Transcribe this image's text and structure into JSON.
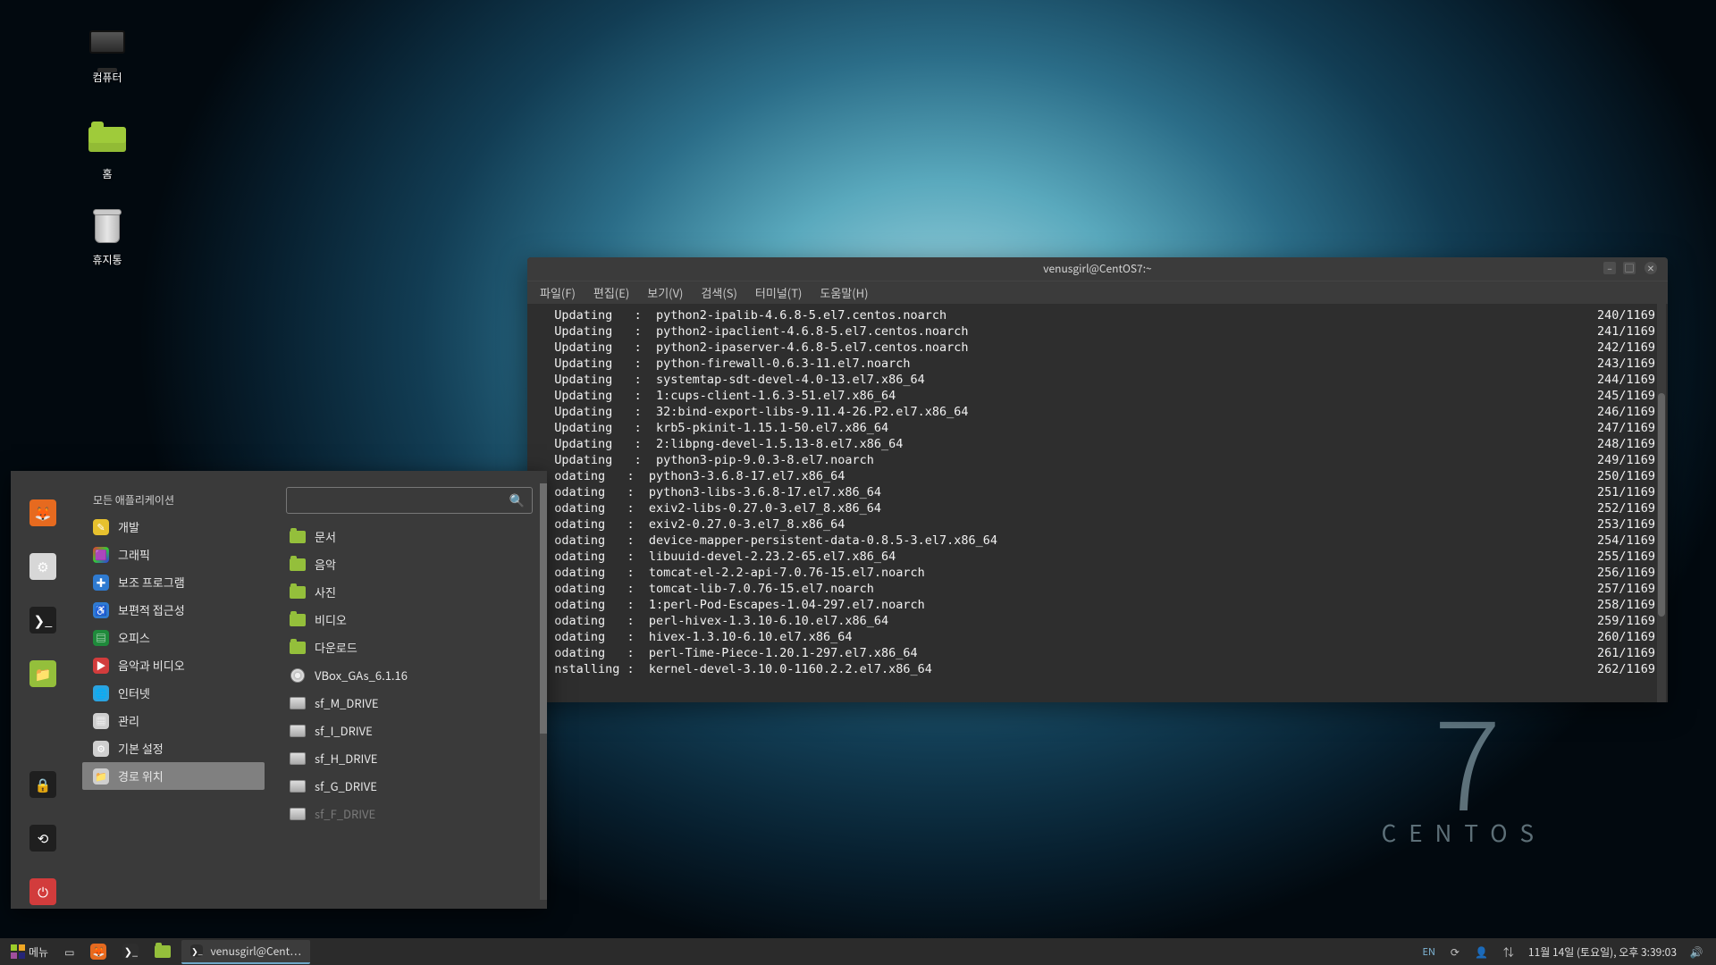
{
  "desktop": {
    "icons": [
      {
        "name": "computer",
        "label": "컴퓨터"
      },
      {
        "name": "home",
        "label": "홈"
      },
      {
        "name": "trash",
        "label": "휴지통"
      }
    ]
  },
  "wallpaper": {
    "big": "7",
    "name": "CENTOS"
  },
  "terminal": {
    "title": "venusgirl@CentOS7:~",
    "menu": [
      "파일(F)",
      "편집(E)",
      "보기(V)",
      "검색(S)",
      "터미널(T)",
      "도움말(H)"
    ],
    "total": "1169",
    "lines": [
      {
        "action": "Updating",
        "sep": "   :  ",
        "pkg": "python2-ipalib-4.6.8-5.el7.centos.noarch",
        "count": "240"
      },
      {
        "action": "Updating",
        "sep": "   :  ",
        "pkg": "python2-ipaclient-4.6.8-5.el7.centos.noarch",
        "count": "241"
      },
      {
        "action": "Updating",
        "sep": "   :  ",
        "pkg": "python2-ipaserver-4.6.8-5.el7.centos.noarch",
        "count": "242"
      },
      {
        "action": "Updating",
        "sep": "   :  ",
        "pkg": "python-firewall-0.6.3-11.el7.noarch",
        "count": "243"
      },
      {
        "action": "Updating",
        "sep": "   :  ",
        "pkg": "systemtap-sdt-devel-4.0-13.el7.x86_64",
        "count": "244"
      },
      {
        "action": "Updating",
        "sep": "   :  ",
        "pkg": "1:cups-client-1.6.3-51.el7.x86_64",
        "count": "245"
      },
      {
        "action": "Updating",
        "sep": "   :  ",
        "pkg": "32:bind-export-libs-9.11.4-26.P2.el7.x86_64",
        "count": "246"
      },
      {
        "action": "Updating",
        "sep": "   :  ",
        "pkg": "krb5-pkinit-1.15.1-50.el7.x86_64",
        "count": "247"
      },
      {
        "action": "Updating",
        "sep": "   :  ",
        "pkg": "2:libpng-devel-1.5.13-8.el7.x86_64",
        "count": "248"
      },
      {
        "action": "Updating",
        "sep": "   :  ",
        "pkg": "python3-pip-9.0.3-8.el7.noarch",
        "count": "249"
      },
      {
        "action": "odating",
        "sep": "   :  ",
        "pkg": "python3-3.6.8-17.el7.x86_64",
        "count": "250"
      },
      {
        "action": "odating",
        "sep": "   :  ",
        "pkg": "python3-libs-3.6.8-17.el7.x86_64",
        "count": "251"
      },
      {
        "action": "odating",
        "sep": "   :  ",
        "pkg": "exiv2-libs-0.27.0-3.el7_8.x86_64",
        "count": "252"
      },
      {
        "action": "odating",
        "sep": "   :  ",
        "pkg": "exiv2-0.27.0-3.el7_8.x86_64",
        "count": "253"
      },
      {
        "action": "odating",
        "sep": "   :  ",
        "pkg": "device-mapper-persistent-data-0.8.5-3.el7.x86_64",
        "count": "254"
      },
      {
        "action": "odating",
        "sep": "   :  ",
        "pkg": "libuuid-devel-2.23.2-65.el7.x86_64",
        "count": "255"
      },
      {
        "action": "odating",
        "sep": "   :  ",
        "pkg": "tomcat-el-2.2-api-7.0.76-15.el7.noarch",
        "count": "256"
      },
      {
        "action": "odating",
        "sep": "   :  ",
        "pkg": "tomcat-lib-7.0.76-15.el7.noarch",
        "count": "257"
      },
      {
        "action": "odating",
        "sep": "   :  ",
        "pkg": "1:perl-Pod-Escapes-1.04-297.el7.noarch",
        "count": "258"
      },
      {
        "action": "odating",
        "sep": "   :  ",
        "pkg": "perl-hivex-1.3.10-6.10.el7.x86_64",
        "count": "259"
      },
      {
        "action": "odating",
        "sep": "   :  ",
        "pkg": "hivex-1.3.10-6.10.el7.x86_64",
        "count": "260"
      },
      {
        "action": "odating",
        "sep": "   :  ",
        "pkg": "perl-Time-Piece-1.20.1-297.el7.x86_64",
        "count": "261"
      },
      {
        "action": "nstalling",
        "sep": " :  ",
        "pkg": "kernel-devel-3.10.0-1160.2.2.el7.x86_64",
        "count": "262"
      }
    ]
  },
  "menu": {
    "search_placeholder": "",
    "header": "모든 애플리케이션",
    "categories": [
      {
        "label": "개발",
        "icon": "dev",
        "color": "#e7c12e"
      },
      {
        "label": "그래픽",
        "icon": "gfx",
        "color": ""
      },
      {
        "label": "보조 프로그램",
        "icon": "acc",
        "color": "#2f7bd1"
      },
      {
        "label": "보편적 접근성",
        "icon": "access",
        "color": "#2f7bd1"
      },
      {
        "label": "오피스",
        "icon": "office",
        "color": "#1f8a3b"
      },
      {
        "label": "음악과 비디오",
        "icon": "media",
        "color": "#d23c3c"
      },
      {
        "label": "인터넷",
        "icon": "net",
        "color": "#2aa3e0"
      },
      {
        "label": "관리",
        "icon": "admin",
        "color": "#cfcfcf"
      },
      {
        "label": "기본 설정",
        "icon": "pref",
        "color": "#cfcfcf"
      },
      {
        "label": "경로 위치",
        "icon": "places",
        "color": "#cfcfcf",
        "selected": true
      }
    ],
    "places": [
      {
        "label": "문서",
        "kind": "folder"
      },
      {
        "label": "음악",
        "kind": "folder"
      },
      {
        "label": "사진",
        "kind": "folder"
      },
      {
        "label": "비디오",
        "kind": "folder"
      },
      {
        "label": "다운로드",
        "kind": "folder"
      },
      {
        "label": "VBox_GAs_6.1.16",
        "kind": "disc"
      },
      {
        "label": "sf_M_DRIVE",
        "kind": "drive"
      },
      {
        "label": "sf_I_DRIVE",
        "kind": "drive"
      },
      {
        "label": "sf_H_DRIVE",
        "kind": "drive"
      },
      {
        "label": "sf_G_DRIVE",
        "kind": "drive"
      },
      {
        "label": "sf_F_DRIVE",
        "kind": "drive",
        "disabled": true
      }
    ],
    "rail": [
      "firefox",
      "toggle",
      "terminal",
      "files",
      "lock",
      "logout",
      "power"
    ]
  },
  "taskbar": {
    "menu_label": "메뉴",
    "task_title": "venusgirl@Cent…",
    "lang": "EN",
    "clock": "11월 14일 (토요일), 오후 3:39:03"
  }
}
